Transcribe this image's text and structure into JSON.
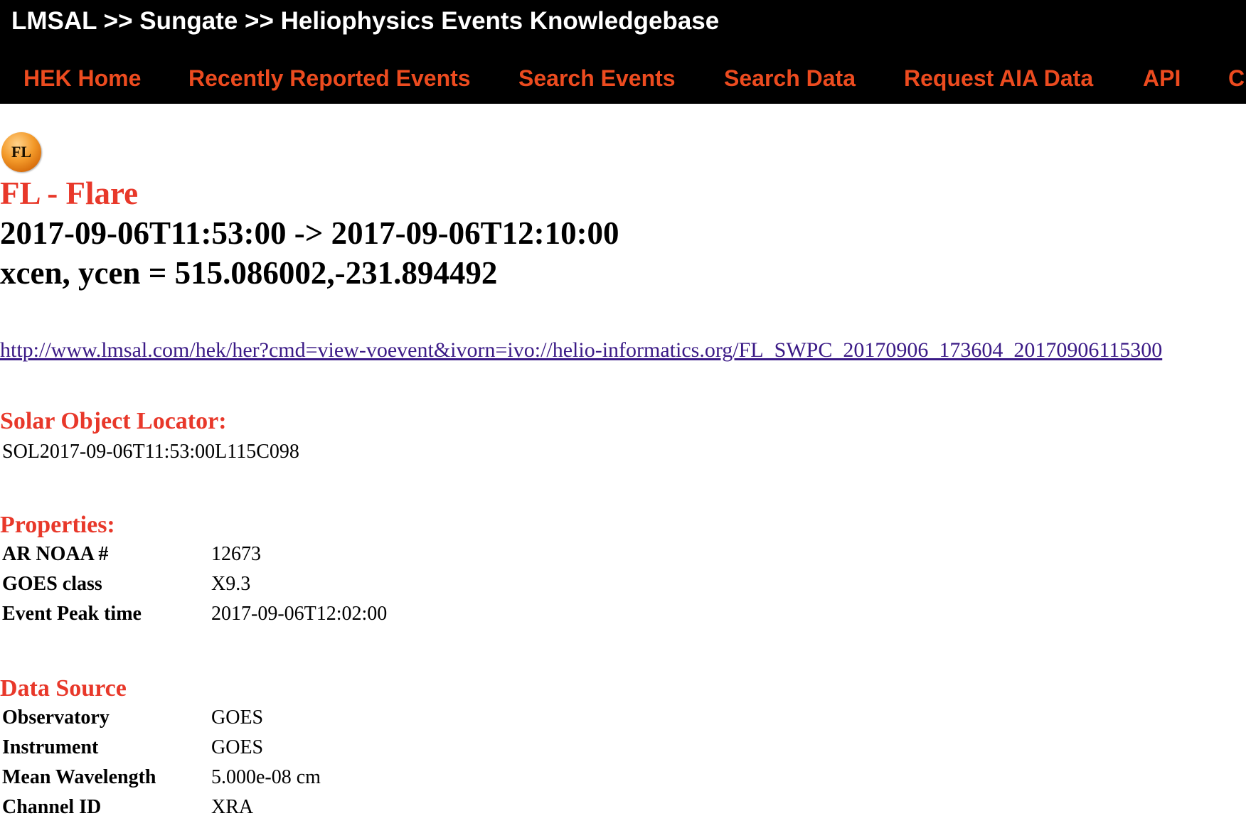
{
  "header": {
    "breadcrumb": "LMSAL >> Sungate >> Heliophysics Events Knowledgebase"
  },
  "nav": [
    {
      "label": "HEK Home"
    },
    {
      "label": "Recently Reported Events"
    },
    {
      "label": "Search Events"
    },
    {
      "label": "Search Data"
    },
    {
      "label": "Request AIA Data"
    },
    {
      "label": "API"
    },
    {
      "label": "C"
    }
  ],
  "event": {
    "icon_label": "FL",
    "title": "FL - Flare",
    "time_range": "2017-09-06T11:53:00 -> 2017-09-06T12:10:00",
    "center": "xcen, ycen = 515.086002,-231.894492",
    "voevent_link": "http://www.lmsal.com/hek/her?cmd=view-voevent&ivorn=ivo://helio-informatics.org/FL_SWPC_20170906_173604_20170906115300"
  },
  "locator": {
    "heading": "Solar Object Locator:",
    "value": "SOL2017-09-06T11:53:00L115C098"
  },
  "properties": {
    "heading": "Properties:",
    "rows": [
      {
        "label": "AR NOAA #",
        "value": "12673"
      },
      {
        "label": "GOES class",
        "value": "X9.3"
      },
      {
        "label": "Event Peak time",
        "value": "2017-09-06T12:02:00"
      }
    ]
  },
  "data_source": {
    "heading": "Data Source",
    "rows": [
      {
        "label": "Observatory",
        "value": "GOES"
      },
      {
        "label": "Instrument",
        "value": "GOES"
      },
      {
        "label": "Mean Wavelength",
        "value": "5.000e-08 cm"
      },
      {
        "label": "Channel ID",
        "value": "XRA"
      }
    ]
  },
  "colors": {
    "topbar_bg": "#000000",
    "nav_link": "#ec4b1f",
    "heading_red": "#e8382a",
    "link": "#3b1a86"
  }
}
